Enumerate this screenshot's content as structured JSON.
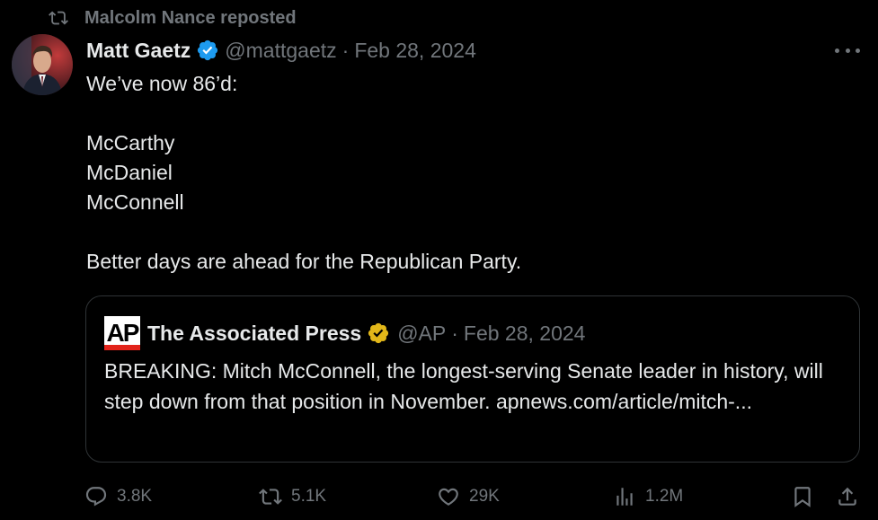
{
  "repost": {
    "label": "Malcolm Nance reposted",
    "icon": "repost-icon"
  },
  "tweet": {
    "author_name": "Matt Gaetz",
    "handle": "@mattgaetz",
    "separator": "·",
    "date": "Feb 28, 2024",
    "verified_color": "#1d9bf0",
    "lines": [
      "We’ve now 86’d:",
      "",
      "McCarthy",
      "McDaniel",
      "McConnell",
      "",
      "Better days are ahead for the Republican Party."
    ]
  },
  "quote": {
    "logo_text": "AP",
    "author_name": "The Associated Press",
    "handle": "@AP",
    "separator": "·",
    "date": "Feb 28, 2024",
    "verified_color": "#e2b719",
    "text": "BREAKING: Mitch McConnell, the longest-serving Senate leader in history, will step down from that position in November.  apnews.com/article/mitch-..."
  },
  "actions": {
    "reply_count": "3.8K",
    "repost_count": "5.1K",
    "like_count": "29K",
    "views_count": "1.2M"
  },
  "colors": {
    "background": "#000000",
    "text": "#e7e9ea",
    "muted": "#71767b",
    "border": "#2f3336"
  }
}
